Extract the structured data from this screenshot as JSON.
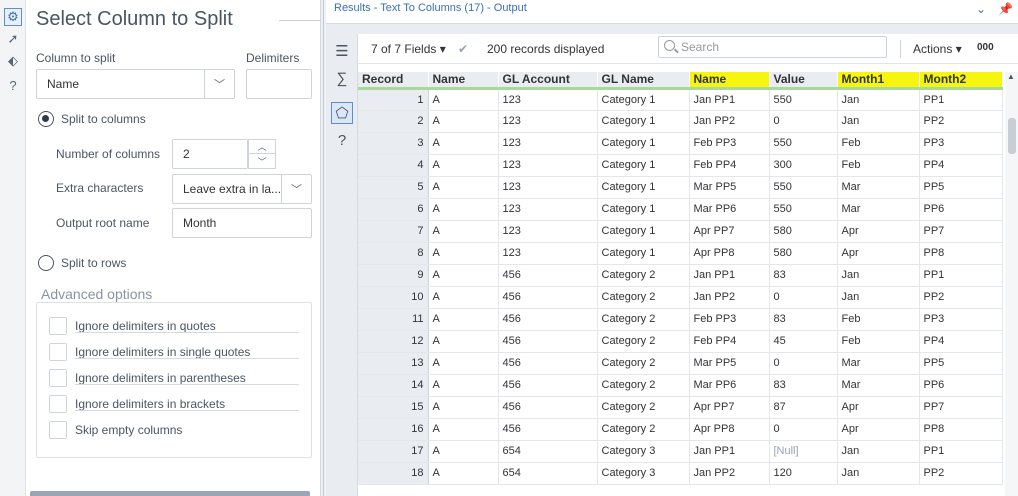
{
  "left_strip": {
    "icons": [
      "gear-icon",
      "compass-icon",
      "tag-icon",
      "help-icon"
    ]
  },
  "config": {
    "title": "Select Column to Split",
    "column_to_split_label": "Column to split",
    "column_to_split_value": "Name",
    "delimiters_label": "Delimiters",
    "delimiters_value": "",
    "split_to_columns_label": "Split to columns",
    "number_of_columns_label": "Number of columns",
    "number_of_columns_value": "2",
    "extra_characters_label": "Extra characters",
    "extra_characters_value": "Leave extra in la...",
    "output_root_name_label": "Output root name",
    "output_root_name_value": "Month",
    "split_to_rows_label": "Split to rows",
    "advanced_title": "Advanced options",
    "advanced_options": [
      "Ignore delimiters in quotes",
      "Ignore delimiters in single quotes",
      "Ignore delimiters in parentheses",
      "Ignore delimiters in brackets",
      "Skip empty columns"
    ]
  },
  "results": {
    "title": "Results - Text To Columns (17) - Output",
    "fields_label": "7 of 7 Fields",
    "records_displayed": "200 records displayed",
    "search_placeholder": "Search",
    "actions_label": "Actions",
    "more_label": "000",
    "columns": [
      "Record",
      "Name",
      "GL Account",
      "GL Name",
      "Name",
      "Value",
      "Month1",
      "Month2"
    ],
    "highlighted_columns": [
      "Name",
      "Month1",
      "Month2"
    ],
    "highlight_color": "#f5f50f",
    "rows": [
      [
        "1",
        "A",
        "123",
        "Category 1",
        "Jan PP1",
        "550",
        "Jan",
        "PP1"
      ],
      [
        "2",
        "A",
        "123",
        "Category 1",
        "Jan PP2",
        "0",
        "Jan",
        "PP2"
      ],
      [
        "3",
        "A",
        "123",
        "Category 1",
        "Feb PP3",
        "550",
        "Feb",
        "PP3"
      ],
      [
        "4",
        "A",
        "123",
        "Category 1",
        "Feb PP4",
        "300",
        "Feb",
        "PP4"
      ],
      [
        "5",
        "A",
        "123",
        "Category 1",
        "Mar PP5",
        "550",
        "Mar",
        "PP5"
      ],
      [
        "6",
        "A",
        "123",
        "Category 1",
        "Mar PP6",
        "550",
        "Mar",
        "PP6"
      ],
      [
        "7",
        "A",
        "123",
        "Category 1",
        "Apr PP7",
        "580",
        "Apr",
        "PP7"
      ],
      [
        "8",
        "A",
        "123",
        "Category 1",
        "Apr PP8",
        "580",
        "Apr",
        "PP8"
      ],
      [
        "9",
        "A",
        "456",
        "Category 2",
        "Jan PP1",
        "83",
        "Jan",
        "PP1"
      ],
      [
        "10",
        "A",
        "456",
        "Category 2",
        "Jan PP2",
        "0",
        "Jan",
        "PP2"
      ],
      [
        "11",
        "A",
        "456",
        "Category 2",
        "Feb PP3",
        "83",
        "Feb",
        "PP3"
      ],
      [
        "12",
        "A",
        "456",
        "Category 2",
        "Feb PP4",
        "45",
        "Feb",
        "PP4"
      ],
      [
        "13",
        "A",
        "456",
        "Category 2",
        "Mar PP5",
        "0",
        "Mar",
        "PP5"
      ],
      [
        "14",
        "A",
        "456",
        "Category 2",
        "Mar PP6",
        "83",
        "Mar",
        "PP6"
      ],
      [
        "15",
        "A",
        "456",
        "Category 2",
        "Apr PP7",
        "87",
        "Apr",
        "PP7"
      ],
      [
        "16",
        "A",
        "456",
        "Category 2",
        "Apr PP8",
        "0",
        "Apr",
        "PP8"
      ],
      [
        "17",
        "A",
        "654",
        "Category 3",
        "Jan PP1",
        "[Null]",
        "Jan",
        "PP1"
      ],
      [
        "18",
        "A",
        "654",
        "Category 3",
        "Jan PP2",
        "120",
        "Jan",
        "PP2"
      ]
    ]
  }
}
